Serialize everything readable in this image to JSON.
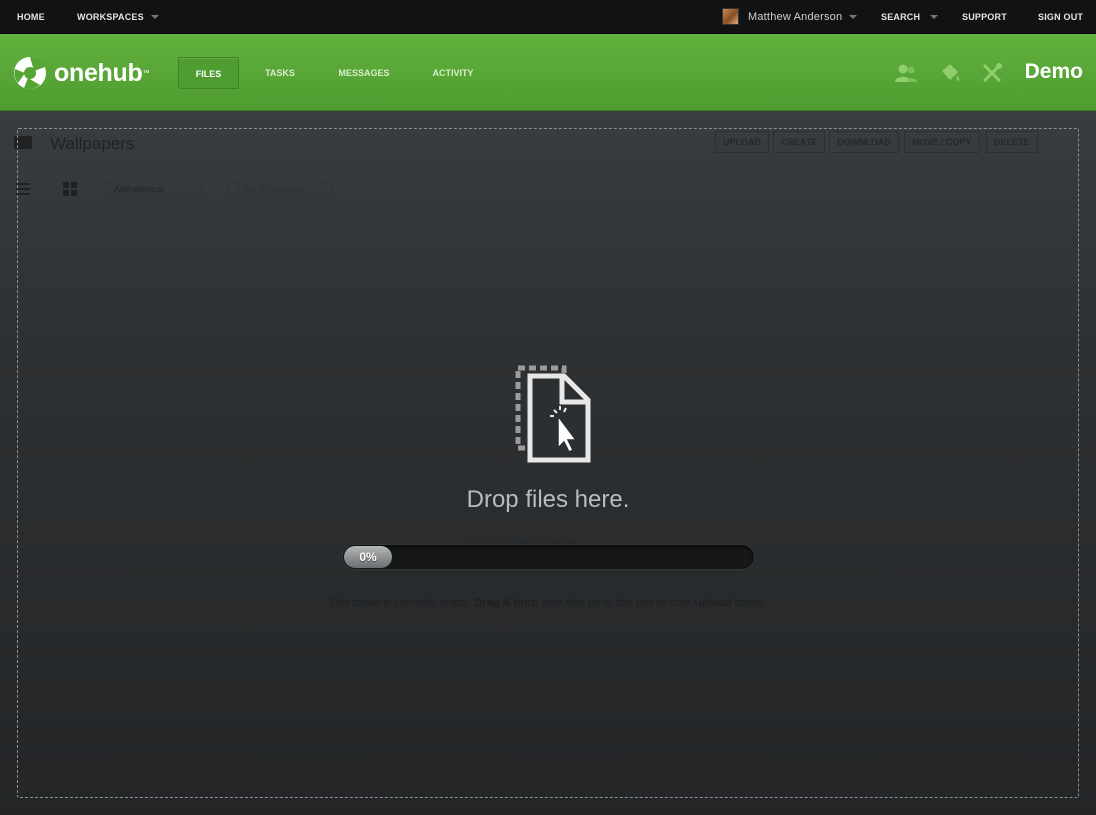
{
  "topbar": {
    "home": "HOME",
    "workspaces": "WORKSPACES",
    "user_name": "Matthew Anderson",
    "search": "SEARCH",
    "support": "SUPPORT",
    "sign_out": "SIGN OUT"
  },
  "header": {
    "logo_text": "onehub",
    "logo_tm": "™",
    "tabs": [
      {
        "label": "FILES",
        "active": true
      },
      {
        "label": "TASKS",
        "active": false
      },
      {
        "label": "MESSAGES",
        "active": false
      },
      {
        "label": "ACTIVITY",
        "active": false
      }
    ],
    "icons": [
      "users-icon",
      "paint-bucket-icon",
      "tools-icon"
    ],
    "brand": "Demo",
    "brand_color": "#55a535"
  },
  "folder": {
    "title": "Wallpapers",
    "actions": [
      "UPLOAD",
      "CREATE",
      "DOWNLOAD",
      "MOVE / COPY",
      "DELETE"
    ],
    "sort_value": "Alphabetical",
    "filter_placeholder": "Filter by filename...",
    "ghost_text": "Drop files here.",
    "empty_note_prefix": "This folder is currently empty.",
    "empty_note_bold1": "Drag & drop",
    "empty_note_mid": "your files on to this box or click",
    "empty_note_bold2": "Upload",
    "empty_note_suffix": "above."
  },
  "dropzone": {
    "text": "Drop files here.",
    "progress_percent": 0,
    "progress_label": "0%"
  }
}
